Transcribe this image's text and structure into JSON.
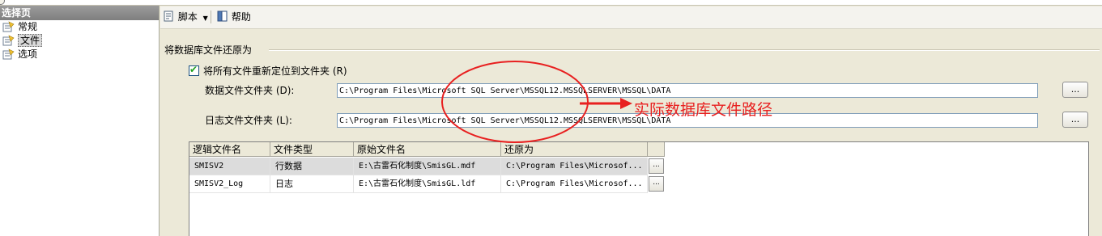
{
  "left_pane": {
    "header": "选择页",
    "items": [
      {
        "label": "常规",
        "icon": "page-icon"
      },
      {
        "label": "文件",
        "icon": "page-icon",
        "selected": true
      },
      {
        "label": "选项",
        "icon": "page-icon"
      }
    ]
  },
  "toolbar": {
    "script_label": "脚本",
    "help_label": "帮助"
  },
  "section": {
    "title": "将数据库文件还原为",
    "relocate_checkbox": {
      "label": "将所有文件重新定位到文件夹 (R)",
      "checked": true
    },
    "data_folder": {
      "label": "数据文件文件夹 (D):",
      "value": "C:\\Program Files\\Microsoft SQL Server\\MSSQL12.MSSQLSERVER\\MSSQL\\DATA",
      "browse_label": "..."
    },
    "log_folder": {
      "label": "日志文件文件夹 (L):",
      "value": "C:\\Program Files\\Microsoft SQL Server\\MSSQL12.MSSQLSERVER\\MSSQL\\DATA",
      "browse_label": "..."
    }
  },
  "grid": {
    "columns": [
      "逻辑文件名",
      "文件类型",
      "原始文件名",
      "还原为"
    ],
    "rows": [
      {
        "logical": "SMISV2",
        "type": "行数据",
        "original": "E:\\古雷石化制度\\SmisGL.mdf",
        "restore_as": "C:\\Program Files\\Microsof...",
        "btn": "...",
        "selected": true
      },
      {
        "logical": "SMISV2_Log",
        "type": "日志",
        "original": "E:\\古雷石化制度\\SmisGL.ldf",
        "restore_as": "C:\\Program Files\\Microsof...",
        "btn": "..."
      }
    ]
  },
  "annotation": {
    "text": "实际数据库文件路径",
    "color": "#e82020"
  }
}
